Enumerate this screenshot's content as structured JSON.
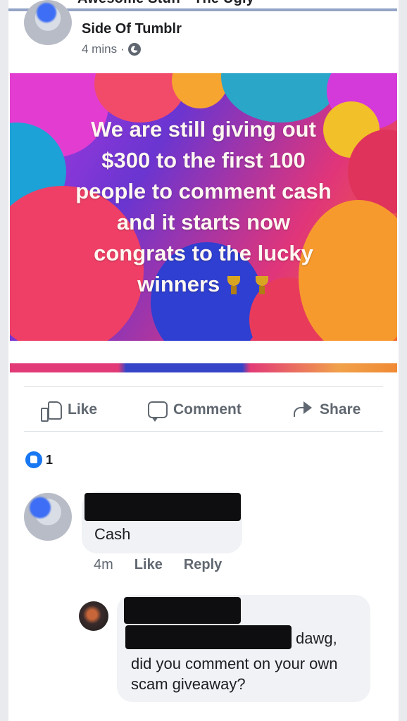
{
  "post": {
    "header_cut_text": "Awesome Stuff - The Ugly",
    "page_name": "Side Of Tumblr",
    "time": "4 mins",
    "separator": "·",
    "image_caption_lines": [
      "We are still giving out",
      "$300 to the first 100",
      "people to comment cash",
      "and it starts now",
      "congrats to the lucky",
      "winners"
    ]
  },
  "actions": {
    "like": "Like",
    "comment": "Comment",
    "share": "Share"
  },
  "reactions": {
    "count": "1"
  },
  "comment": {
    "text": "Cash",
    "time": "4m",
    "like": "Like",
    "reply": "Reply"
  },
  "reply": {
    "first": "dawg,",
    "rest": "did you comment on your own scam giveaway?"
  },
  "colors": {
    "facebook_blue": "#1877f2",
    "muted_text": "#606770"
  }
}
